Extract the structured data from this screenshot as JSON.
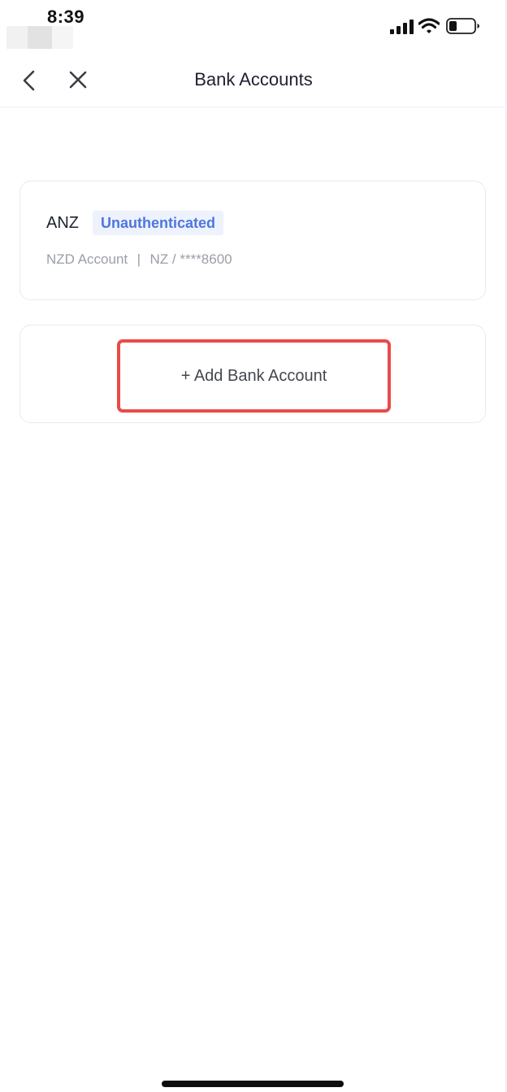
{
  "status_bar": {
    "time": "8:39",
    "icons": [
      "signal-icon",
      "wifi-icon",
      "battery-icon"
    ]
  },
  "nav": {
    "title": "Bank Accounts",
    "back_icon": "chevron-left-icon",
    "close_icon": "close-icon"
  },
  "accounts": [
    {
      "bank_name": "ANZ",
      "status": "Unauthenticated",
      "account_type": "NZD Account",
      "separator": "|",
      "country_and_number": "NZ / ****8600"
    }
  ],
  "add_account": {
    "label": "+ Add Bank Account"
  },
  "colors": {
    "badge_text": "#4f76e0",
    "badge_background": "#edf2fd",
    "highlight_border": "#e94b4b",
    "card_border": "#e4ecec"
  }
}
